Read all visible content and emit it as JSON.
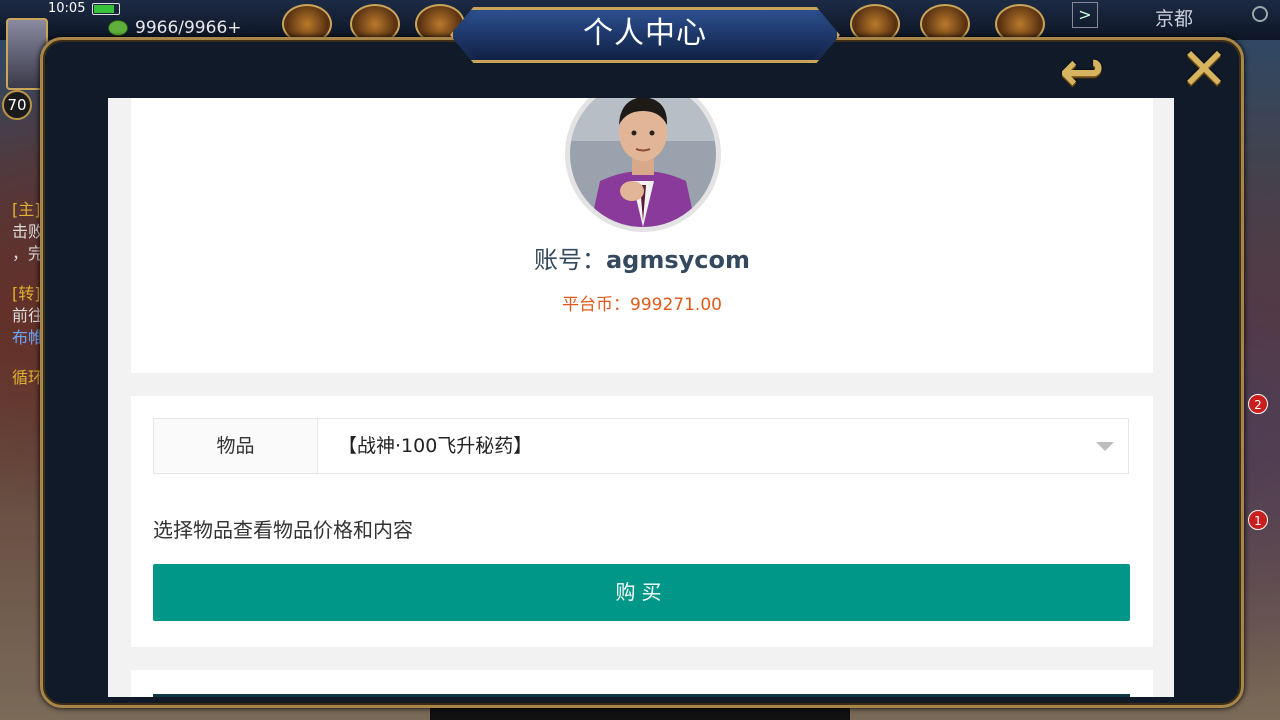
{
  "hud": {
    "time": "10:05",
    "stamina": "9966/9966",
    "stamina_plus": "+",
    "level": "70",
    "city": "京都"
  },
  "side_text": {
    "quest_main": "[主]",
    "quest_main_line1": "击败",
    "quest_main_line2": "，完",
    "quest_transfer": "[转]",
    "quest_transfer_line1": "前往",
    "quest_transfer_line2": "布帷",
    "quest_loop": "循环"
  },
  "badges": {
    "badge_a": "2",
    "badge_b": "1"
  },
  "dialog": {
    "title": "个人中心",
    "back_glyph": "↩",
    "close_glyph": "✕"
  },
  "profile": {
    "account_label": "账号：",
    "account_name": "agmsycom",
    "balance_label": "平台币：",
    "balance_value": "999271.00"
  },
  "purchase": {
    "item_label": "物品",
    "item_selected": "【战神·100飞升秘药】",
    "hint": "选择物品查看物品价格和内容",
    "buy_label": "购买"
  },
  "colors": {
    "buy_button": "#009688",
    "balance": "#e05a1c",
    "account": "#34495e",
    "frame_gold": "#a8864a"
  }
}
